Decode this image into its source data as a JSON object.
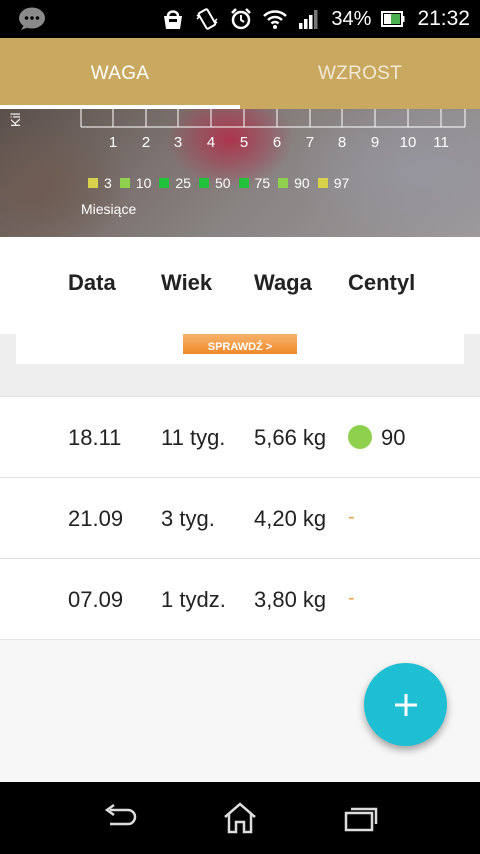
{
  "status_bar": {
    "battery_percent": "34%",
    "time": "21:32",
    "icons": [
      "chat-icon",
      "handbag-icon",
      "vibrate-icon",
      "alarm-icon",
      "wifi-icon",
      "signal-icon",
      "battery-icon"
    ]
  },
  "tabs": [
    {
      "label": "WAGA",
      "selected": true
    },
    {
      "label": "WZROST",
      "selected": false
    }
  ],
  "chart": {
    "y_axis_label": "Kil",
    "x_ticks": [
      "1",
      "2",
      "3",
      "4",
      "5",
      "6",
      "7",
      "8",
      "9",
      "10",
      "11"
    ],
    "x_label": "Miesiące",
    "legend": [
      {
        "label": "3",
        "color": "#d7d24a"
      },
      {
        "label": "10",
        "color": "#8fd14f"
      },
      {
        "label": "25",
        "color": "#22c33a"
      },
      {
        "label": "50",
        "color": "#22c33a"
      },
      {
        "label": "75",
        "color": "#22c33a"
      },
      {
        "label": "90",
        "color": "#8fd14f"
      },
      {
        "label": "97",
        "color": "#d7d24a"
      }
    ]
  },
  "table": {
    "headers": {
      "date": "Data",
      "age": "Wiek",
      "weight": "Waga",
      "percentile": "Centyl"
    },
    "rows": [
      {
        "date": "18.11",
        "age": "11 tyg.",
        "weight": "5,66 kg",
        "percentile": "90",
        "dot_color": "#8fd14f"
      },
      {
        "date": "21.09",
        "age": "3 tyg.",
        "weight": "4,20 kg",
        "percentile": "-"
      },
      {
        "date": "07.09",
        "age": "1 tydz.",
        "weight": "3,80 kg",
        "percentile": "-"
      }
    ]
  },
  "ad": {
    "button_text": "SPRAWDŹ >"
  },
  "colors": {
    "accent": "#c9a860",
    "fab": "#1fbfd3",
    "dash": "#e8a24a"
  }
}
